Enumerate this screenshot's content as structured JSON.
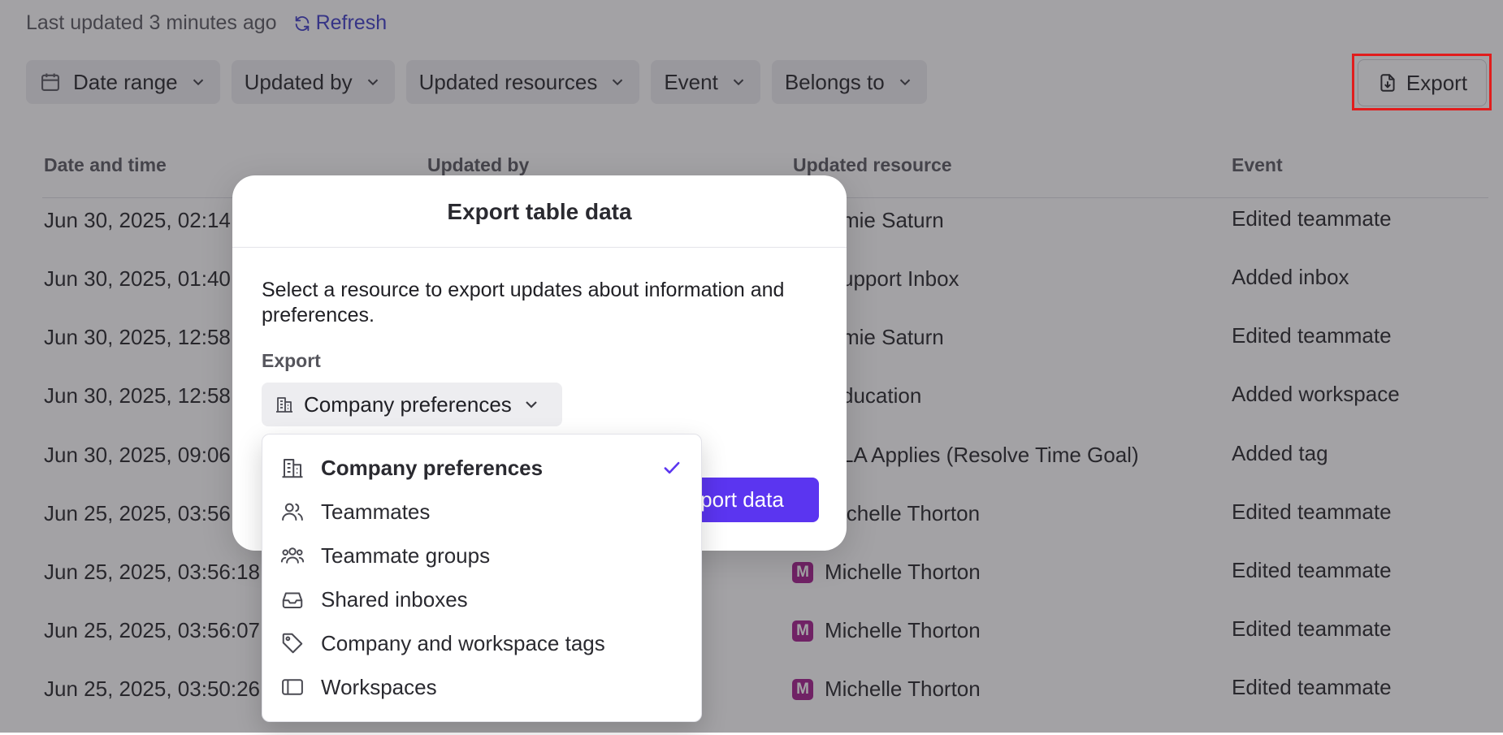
{
  "header": {
    "last_updated": "Last updated 3 minutes ago",
    "refresh_label": "Refresh"
  },
  "filters": [
    {
      "label": "Date range",
      "icon": "calendar-icon"
    },
    {
      "label": "Updated by"
    },
    {
      "label": "Updated resources"
    },
    {
      "label": "Event"
    },
    {
      "label": "Belongs to"
    }
  ],
  "export_button": {
    "label": "Export",
    "icon": "file-download-icon"
  },
  "table": {
    "columns": [
      "Date and time",
      "Updated by",
      "Updated resource",
      "Event"
    ],
    "rows": [
      {
        "datetime": "Jun 30, 2025, 02:14",
        "resource": "mie Saturn",
        "event": "Edited teammate"
      },
      {
        "datetime": "Jun 30, 2025, 01:40",
        "resource": "upport Inbox",
        "event": "Added inbox"
      },
      {
        "datetime": "Jun 30, 2025, 12:58",
        "resource": "mie Saturn",
        "event": "Edited teammate"
      },
      {
        "datetime": "Jun 30, 2025, 12:58",
        "resource": "ducation",
        "event": "Added workspace"
      },
      {
        "datetime": "Jun 30, 2025, 09:06",
        "resource": "LA Applies (Resolve Time Goal)",
        "event": "Added tag"
      },
      {
        "datetime": "Jun 25, 2025, 03:56",
        "resource": "ichelle Thorton",
        "event": "Edited teammate"
      },
      {
        "datetime": "Jun 25, 2025, 03:56:18",
        "avatar": "M",
        "resource": "Michelle Thorton",
        "event": "Edited teammate"
      },
      {
        "datetime": "Jun 25, 2025, 03:56:07",
        "avatar": "M",
        "resource": "Michelle Thorton",
        "event": "Edited teammate"
      },
      {
        "datetime": "Jun 25, 2025, 03:50:26",
        "avatar": "M",
        "resource": "Michelle Thorton",
        "event": "Edited teammate"
      }
    ]
  },
  "modal": {
    "title": "Export table data",
    "description": "Select a resource to export updates about information and preferences.",
    "field_label": "Export",
    "selected": "Company preferences",
    "primary_button": "xport data"
  },
  "dropdown": {
    "options": [
      {
        "label": "Company preferences",
        "icon": "building-icon",
        "selected": true
      },
      {
        "label": "Teammates",
        "icon": "users-icon"
      },
      {
        "label": "Teammate groups",
        "icon": "user-group-icon"
      },
      {
        "label": "Shared inboxes",
        "icon": "inbox-icon"
      },
      {
        "label": "Company and workspace tags",
        "icon": "tag-icon"
      },
      {
        "label": "Workspaces",
        "icon": "workspace-icon"
      }
    ]
  },
  "colors": {
    "accent": "#5b35f0",
    "link": "#3a37c6",
    "avatar": "#a3178a",
    "highlight": "#e11d1d"
  }
}
